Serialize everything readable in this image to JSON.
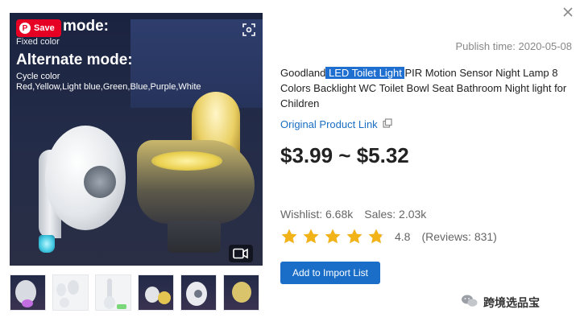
{
  "modal": {
    "close_icon": "close-icon"
  },
  "image_overlay": {
    "save_label": "Save",
    "mode_heading": "mode:",
    "fixed_sub": "Fixed color",
    "alternate_heading": "Alternate mode:",
    "cycle_sub": "Cycle color",
    "colors_sub": "Red,Yellow,Light blue,Green,Blue,Purple,White",
    "lens_icon": "visual-search-icon",
    "video_icon": "video-icon"
  },
  "thumbnails": [
    {
      "name": "thumb-1"
    },
    {
      "name": "thumb-2"
    },
    {
      "name": "thumb-3"
    },
    {
      "name": "thumb-4"
    },
    {
      "name": "thumb-5"
    },
    {
      "name": "thumb-6"
    }
  ],
  "product": {
    "publish_time": "Publish time: 2020-05-08",
    "title_pre": "Goodland",
    "title_highlight": " LED Toilet Light ",
    "title_post": "PIR Motion Sensor Night Lamp 8 Colors Backlight WC Toilet Bowl Seat Bathroom Night light for Children",
    "original_link": "Original Product Link",
    "price": "$3.99 ~ $5.32",
    "wishlist": "Wishlist: 6.68k",
    "sales": "Sales: 2.03k",
    "rating": "4.8",
    "rating_stars": 4.8,
    "reviews": "(Reviews: 831)",
    "add_button": "Add to Import List"
  },
  "watermark": {
    "text": "跨境选品宝"
  },
  "colors": {
    "accent_blue": "#1a6ec7",
    "highlight_blue": "#1e6fd0",
    "star_gold": "#f2b319",
    "pinterest_red": "#e60023"
  }
}
